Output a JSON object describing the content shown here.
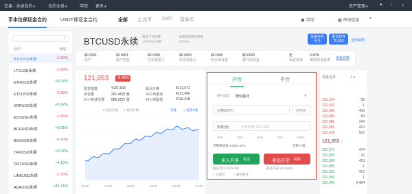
{
  "topnav": {
    "items": [
      "交易 - 永续合约",
      "合约业务",
      "学院",
      "更多"
    ],
    "asset_mgmt": "资产管理"
  },
  "categories": {
    "tabs": [
      "币本位保证金合约",
      "USDT保证金合约"
    ],
    "filters": [
      "全部",
      "主流币",
      "DeFi",
      "竞争币"
    ],
    "right_items": [
      "活动",
      "市场信息"
    ]
  },
  "sidebar": {
    "header_left": "合约",
    "header_right": "涨幅 ↑",
    "items": [
      {
        "symbol": "BTCUSD永续",
        "change": "-1.26%",
        "dir": "down",
        "selected": true
      },
      {
        "symbol": "LTCUSD永续",
        "change": "-1.99%",
        "dir": "down"
      },
      {
        "symbol": "ETHUSD永续",
        "change": "+6.07%",
        "dir": "up"
      },
      {
        "symbol": "ETCUSD永续",
        "change": "-0.95%",
        "dir": "down"
      },
      {
        "symbol": "XRPUSD永续",
        "change": "+5.02%",
        "dir": "up"
      },
      {
        "symbol": "EOSUSD永续",
        "change": "-1.56%",
        "dir": "down"
      },
      {
        "symbol": "BCHUSD永续",
        "change": "+0.61%",
        "dir": "up"
      },
      {
        "symbol": "BSVUSD永续",
        "change": "-3.70%",
        "dir": "down"
      },
      {
        "symbol": "TRXUSD永续",
        "change": "+0.97%",
        "dir": "up"
      },
      {
        "symbol": "DOTUSD永续",
        "change": "+4.15%",
        "dir": "up"
      },
      {
        "symbol": "LINKUSD永续",
        "change": "-1.70%",
        "dir": "down"
      },
      {
        "symbol": "ADAUSD永续",
        "change": "+20.71%",
        "dir": "up"
      }
    ]
  },
  "header": {
    "title": "BTCUSD永续",
    "sub1_label": "距离下次结算",
    "sub1_value": "12时45分19秒",
    "sub2_label": "本期预测资金费率",
    "sub2_value": "0.001%",
    "btn_contract": "永续合约\n全仓",
    "btn_leverage": "逐仓杠杆\n75.00X",
    "product_link": "合约说明"
  },
  "stats": [
    {
      "value": "$0.0001",
      "label": "资产"
    },
    {
      "value": "$0.0001",
      "label": "用户权益"
    },
    {
      "value": "$0.0000",
      "label": "已实现盈亏"
    },
    {
      "value": "$0.0000",
      "label": "未实现盈亏"
    },
    {
      "value": "$0.0000",
      "label": "持仓保证金"
    },
    {
      "value": "$0.0000",
      "label": "委托保证金"
    },
    {
      "value": "无",
      "label": "保证金率"
    },
    {
      "value": "0.40%",
      "label": "维持保证金率"
    }
  ],
  "stats_link": "资金划转",
  "ticker": {
    "price": "121,053",
    "change_badge": "-0.48%",
    "rows": [
      {
        "label": "现货指数",
        "value": "¥121,633",
        "label2": "最近价格",
        "value2": "¥121,072"
      },
      {
        "label": "持仓量",
        "value": "201.45万 张",
        "label2": "24小时最高",
        "value2": "¥121,490"
      },
      {
        "label": "24小时成交量",
        "value": "856.25万 张",
        "label2": "24小时最低",
        "value2": "¥116,418"
      }
    ],
    "legend_a": "标记价格",
    "legend_b": "合约价格",
    "depth_link": "深度",
    "full_link": "全屏K线",
    "x_ticks": [
      "16:00",
      "17:00",
      "18:00",
      "19:00",
      "20:00",
      "21:00"
    ]
  },
  "chart_data": {
    "type": "line",
    "x": [
      "16:00",
      "17:00",
      "18:00",
      "19:00",
      "20:00",
      "21:00"
    ],
    "series": [
      {
        "values": [
          118600,
          119200,
          120100,
          120700,
          121300,
          121050
        ]
      }
    ],
    "ylim": [
      117000,
      122000
    ]
  },
  "order": {
    "tab_open": "开仓",
    "tab_close": "平仓",
    "type_label": "委托类型",
    "type_value": "限价委托",
    "price_label": "价格(CNY)",
    "opponent": "对手价",
    "qty_label": "数量(张)",
    "qty_placeholder": "可开张数 100 USD",
    "percents": [
      "10%",
      "25%",
      "50%",
      "75%",
      "100%"
    ],
    "avail_label": "可用保证金 0.0001 BTC",
    "avail_right": "可开 0 张",
    "buy": "买入开多",
    "buy_sub": "看涨",
    "sell": "卖出开空",
    "sell_sub": "看跌",
    "max_buy": "最多可开 ¥123,450",
    "max_sell": "最多可开 ¥118,608",
    "opt_a": "只减仓",
    "opt_b": "被动委托"
  },
  "book": {
    "header": "深度合并",
    "asks": [
      {
        "p": "121,104",
        "q": "58"
      },
      {
        "p": "121,103",
        "q": "1"
      },
      {
        "p": "121,098",
        "q": "453"
      },
      {
        "p": "121,095",
        "q": "50"
      },
      {
        "p": "121,086",
        "q": "144"
      },
      {
        "p": "121,083",
        "q": "413"
      },
      {
        "p": "121,079",
        "q": "527"
      }
    ],
    "mid": "121,053 ↓",
    "bids": [
      {
        "p": "121,077",
        "q": "474"
      },
      {
        "p": "121,070",
        "q": "26"
      },
      {
        "p": "121,059",
        "q": "413"
      },
      {
        "p": "121,055",
        "q": "1"
      },
      {
        "p": "121,053",
        "q": "413"
      },
      {
        "p": "121,049",
        "q": "1"
      },
      {
        "p": "121,045",
        "q": "2,484"
      }
    ]
  },
  "colors": {
    "up": "#22a55b",
    "down": "#e14d4d",
    "accent": "#3b7cf6"
  }
}
